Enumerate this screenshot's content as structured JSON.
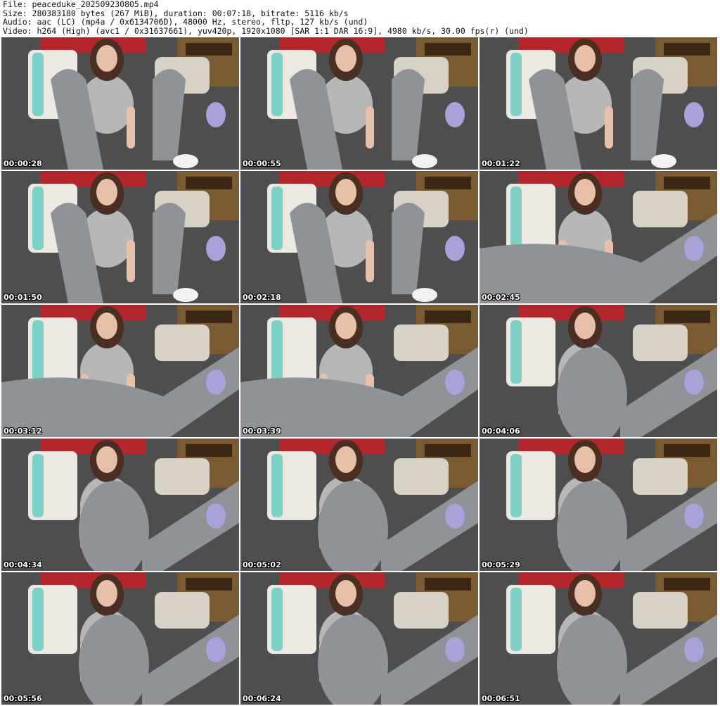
{
  "header": {
    "file": "File: peaceduke_202509230805.mp4",
    "size": "Size: 280383180 bytes (267 MiB), duration: 00:07:18, bitrate: 5116 kb/s",
    "audio": "Audio: aac (LC) (mp4a / 0x6134706D), 48000 Hz, stereo, fltp, 127 kb/s (und)",
    "video": "Video: h264 (High) (avc1 / 0x31637661), yuv420p, 1920x1080 [SAR 1:1 DAR 16:9], 4980 kb/s, 30.00 fps(r) (und)"
  },
  "thumbnails": [
    {
      "timestamp": "00:00:28"
    },
    {
      "timestamp": "00:00:55"
    },
    {
      "timestamp": "00:01:22"
    },
    {
      "timestamp": "00:01:50"
    },
    {
      "timestamp": "00:02:18"
    },
    {
      "timestamp": "00:02:45"
    },
    {
      "timestamp": "00:03:12"
    },
    {
      "timestamp": "00:03:39"
    },
    {
      "timestamp": "00:04:06"
    },
    {
      "timestamp": "00:04:34"
    },
    {
      "timestamp": "00:05:02"
    },
    {
      "timestamp": "00:05:29"
    },
    {
      "timestamp": "00:05:56"
    },
    {
      "timestamp": "00:06:24"
    },
    {
      "timestamp": "00:06:51"
    }
  ],
  "colors": {
    "blanket": "#4e4e4e",
    "pillow_red": "#b3262b",
    "pillow_teal": "#7ed1c6",
    "pillow_white": "#ece8e2",
    "furniture": "#7a5a33",
    "leggings": "#8f9296",
    "skin": "#e8bfa8",
    "hair": "#4a2e22",
    "plush": "#a9a1d9"
  }
}
